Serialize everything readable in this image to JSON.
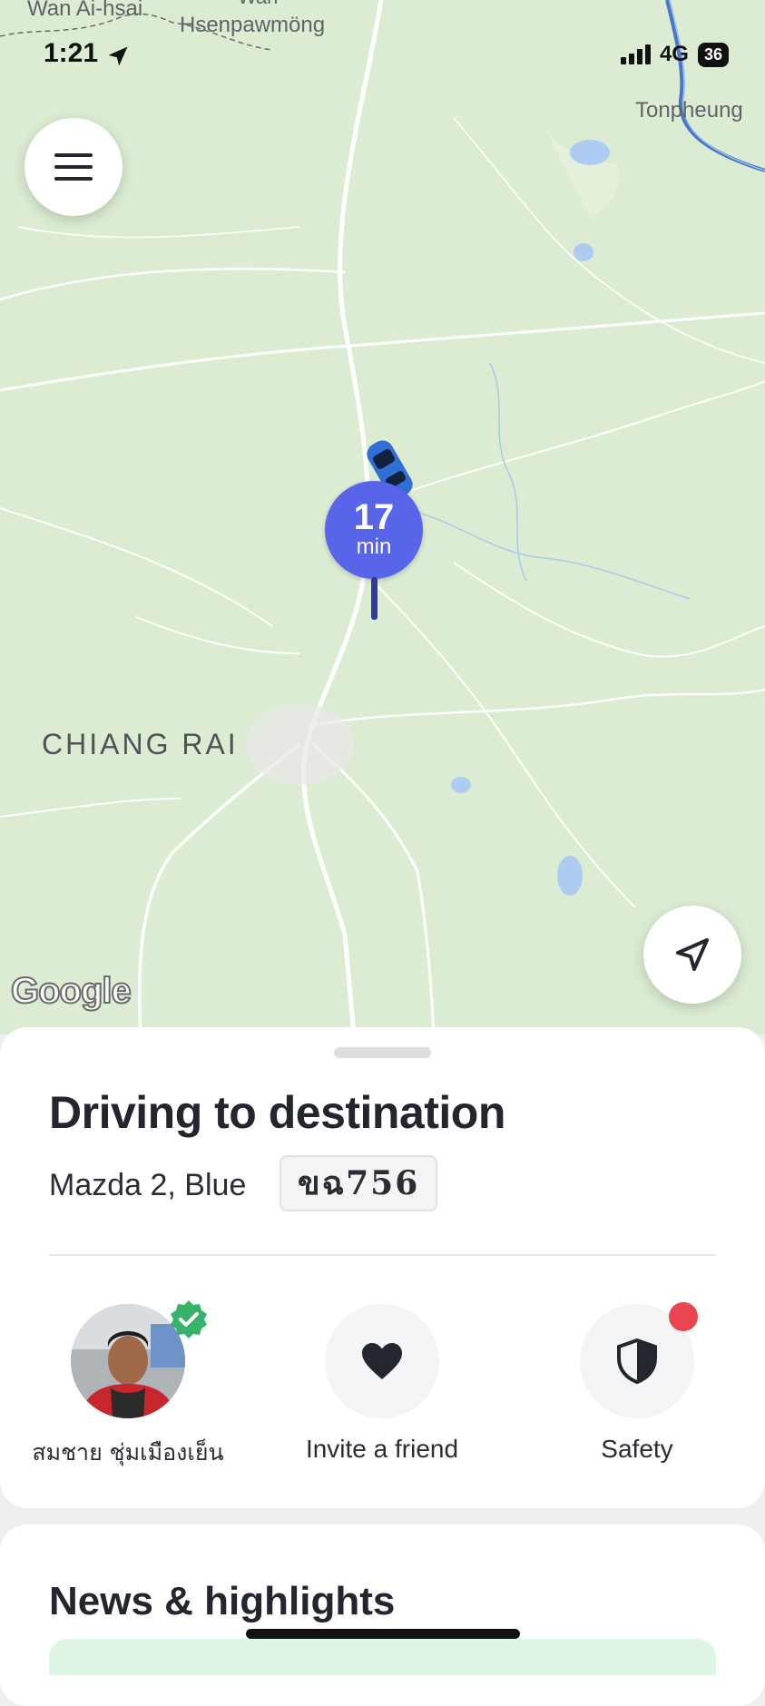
{
  "status_bar": {
    "time": "1:21",
    "network": "4G",
    "battery": "36"
  },
  "map": {
    "labels": {
      "wan_ai_hsai": "Wan Ai-hsai",
      "wan": "Wan",
      "hsenpawmong": "Hsenpawmöng",
      "tonpheung": "Tonpheung",
      "chiang_rai": "CHIANG RAI"
    },
    "eta": {
      "value": "17",
      "unit": "min"
    },
    "attribution": "Google"
  },
  "trip": {
    "status": "Driving to destination",
    "vehicle": "Mazda 2, Blue",
    "plate": "ขฉ756"
  },
  "actions": {
    "driver_name": "สมชาย ชุ่มเมืองเย็น",
    "invite_label": "Invite a friend",
    "safety_label": "Safety"
  },
  "news": {
    "title": "News & highlights"
  },
  "colors": {
    "eta": "#5865e8",
    "accent_red": "#e94550",
    "verified": "#36b36a"
  },
  "icons": [
    "menu-icon",
    "location-arrow-icon",
    "heart-icon",
    "shield-icon",
    "check-icon",
    "car-marker-icon",
    "location-services-icon"
  ]
}
